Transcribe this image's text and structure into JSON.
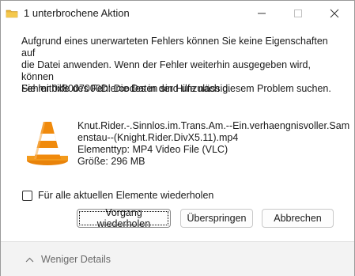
{
  "window": {
    "title": "1 unterbrochene Aktion",
    "minimize_label": "Minimieren",
    "maximize_label": "Maximieren",
    "close_label": "Schließen"
  },
  "message": {
    "line1": "Aufgrund eines unerwarteten Fehlers können Sie keine Eigenschaften auf",
    "line2": "die Datei anwenden. Wenn der Fehler weiterhin ausgegeben wird, können",
    "line3": "Sie mithilfe des Fehlercodes in der Hilfe nach diesem Problem suchen.",
    "error": "Fehler 0x8007000D: Die Daten sind unzulässig."
  },
  "file": {
    "icon": "vlc-cone-icon",
    "name_line1": "Knut.Rider.-.Sinnlos.im.Trans.Am.--Ein.verhaengnisvoller.Sam",
    "name_line2": "enstau--(Knight.Rider.DivX5.11).mp4",
    "type": "Elementtyp: MP4 Video File (VLC)",
    "size": "Größe: 296 MB"
  },
  "checkbox": {
    "label": "Für alle aktuellen Elemente wiederholen",
    "checked": false
  },
  "buttons": {
    "retry": "Vorgang wiederholen",
    "skip": "Überspringen",
    "cancel": "Abbrechen"
  },
  "footer": {
    "less_details": "Weniger Details"
  },
  "colors": {
    "cone_orange": "#f08a0c",
    "footer_bg": "#f3f3f3",
    "accent_folder": "#e8b33a"
  }
}
